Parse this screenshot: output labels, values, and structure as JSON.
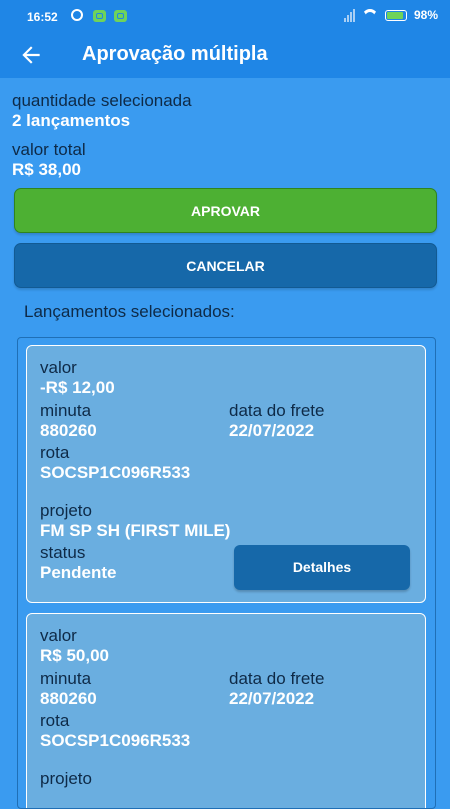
{
  "status_bar": {
    "time": "16:52",
    "battery": "98",
    "icons": [
      "alarm-icon",
      "notification-icon",
      "notification-icon",
      "signal-icon",
      "wifi-icon",
      "battery-icon"
    ]
  },
  "app_bar": {
    "title": "Aprovação múltipla",
    "back_icon": "arrow-left-icon"
  },
  "summary": {
    "quantity_label": "quantidade selecionada",
    "quantity_value": "2 lançamentos",
    "total_label": "valor total",
    "total_value": "R$ 38,00"
  },
  "actions": {
    "approve": "APROVAR",
    "cancel": "CANCELAR"
  },
  "list_title": "Lançamentos selecionados:",
  "labels": {
    "valor": "valor",
    "minuta": "minuta",
    "data_frete": "data do frete",
    "rota": "rota",
    "projeto": "projeto",
    "status": "status"
  },
  "entries": [
    {
      "valor": "-R$ 12,00",
      "minuta": "880260",
      "data_frete": "22/07/2022",
      "rota": "SOCSP1C096R533",
      "projeto": "FM SP SH (FIRST MILE)",
      "status": "Pendente",
      "details_label": "Detalhes"
    },
    {
      "valor": "R$ 50,00",
      "minuta": "880260",
      "data_frete": "22/07/2022",
      "rota": "SOCSP1C096R533"
    }
  ],
  "colors": {
    "background": "#3a9bf0",
    "app_bar": "#1f86e6",
    "approve": "#4db033",
    "cancel": "#1668a9",
    "card": "#6aaee0",
    "label_text": "#0e2a47"
  }
}
